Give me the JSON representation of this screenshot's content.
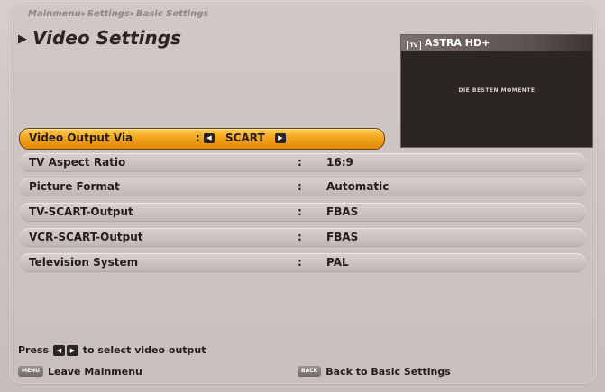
{
  "breadcrumb": {
    "items": [
      "Mainmenu",
      "Settings",
      "Basic Settings"
    ]
  },
  "title": "Video Settings",
  "preview": {
    "channel": "ASTRA HD+",
    "program": "DIE BESTEN MOMENTE"
  },
  "settings": [
    {
      "label": "Video Output Via",
      "colon": ":",
      "value": "SCART",
      "selected": true
    },
    {
      "label": "TV Aspect Ratio",
      "colon": ":",
      "value": "16:9"
    },
    {
      "label": "Picture Format",
      "colon": ":",
      "value": "Automatic"
    },
    {
      "label": "TV-SCART-Output",
      "colon": ":",
      "value": "FBAS"
    },
    {
      "label": "VCR-SCART-Output",
      "colon": ":",
      "value": "FBAS"
    },
    {
      "label": "Television System",
      "colon": ":",
      "value": "PAL"
    }
  ],
  "hint": {
    "press": "Press",
    "action": "to select video output"
  },
  "footer": {
    "left_badge": "MENU",
    "left_label": "Leave Mainmenu",
    "right_badge": "BACK",
    "right_label": "Back to Basic Settings"
  },
  "icons": {
    "left_arrow": "◀",
    "right_arrow": "▶",
    "title_arrow": "▶",
    "tv_icon": "tv-icon"
  },
  "colors": {
    "accent": "#f2a51d",
    "background": "#cfc7c5",
    "text": "#231d1c"
  }
}
